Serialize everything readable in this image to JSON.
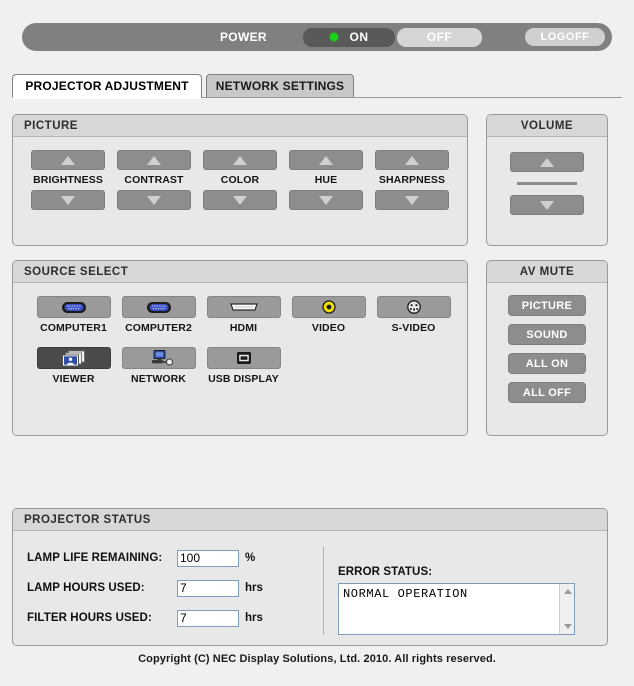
{
  "power": {
    "label": "POWER",
    "on_label": "ON",
    "off_label": "OFF",
    "logoff_label": "LOGOFF",
    "state": "ON",
    "led_color": "#19d419",
    "bar_color": "#808080",
    "on_button_color": "#595959"
  },
  "tabs": [
    {
      "label": "PROJECTOR ADJUSTMENT",
      "active": true
    },
    {
      "label": "NETWORK SETTINGS",
      "active": false
    }
  ],
  "picture": {
    "title": "PICTURE",
    "controls": [
      {
        "label": "BRIGHTNESS",
        "up": "up-triangle",
        "down": "down-triangle"
      },
      {
        "label": "CONTRAST",
        "up": "up-triangle",
        "down": "down-triangle"
      },
      {
        "label": "COLOR",
        "up": "up-triangle",
        "down": "down-triangle"
      },
      {
        "label": "HUE",
        "up": "up-triangle",
        "down": "down-triangle"
      },
      {
        "label": "SHARPNESS",
        "up": "up-triangle",
        "down": "down-triangle"
      }
    ]
  },
  "volume": {
    "title": "VOLUME",
    "up_icon": "up-triangle",
    "down_icon": "down-triangle"
  },
  "source_select": {
    "title": "SOURCE SELECT",
    "row1": [
      {
        "label": "COMPUTER1",
        "icon": "vga-connector-icon",
        "selected": false
      },
      {
        "label": "COMPUTER2",
        "icon": "vga-connector-icon",
        "selected": false
      },
      {
        "label": "HDMI",
        "icon": "hdmi-connector-icon",
        "selected": false
      },
      {
        "label": "VIDEO",
        "icon": "rca-composite-icon",
        "selected": false
      },
      {
        "label": "S-VIDEO",
        "icon": "svideo-din-icon",
        "selected": false
      }
    ],
    "row2": [
      {
        "label": "VIEWER",
        "icon": "photo-stack-icon",
        "selected": true
      },
      {
        "label": "NETWORK",
        "icon": "network-monitor-icon",
        "selected": false
      },
      {
        "label": "USB DISPLAY",
        "icon": "usb-port-icon",
        "selected": false
      }
    ]
  },
  "av_mute": {
    "title": "AV MUTE",
    "buttons": [
      {
        "label": "PICTURE"
      },
      {
        "label": "SOUND"
      },
      {
        "label": "ALL ON"
      },
      {
        "label": "ALL OFF"
      }
    ]
  },
  "projector_status": {
    "title": "PROJECTOR STATUS",
    "rows": [
      {
        "name": "LAMP LIFE REMAINING:",
        "value": "100",
        "unit": "%"
      },
      {
        "name": "LAMP HOURS USED:",
        "value": "7",
        "unit": "hrs"
      },
      {
        "name": "FILTER HOURS USED:",
        "value": "7",
        "unit": "hrs"
      }
    ],
    "error_status_label": "ERROR STATUS:",
    "error_status_text": "NORMAL OPERATION"
  },
  "footer": {
    "copyright": "Copyright (C) NEC Display Solutions, Ltd. 2010. All rights reserved."
  }
}
